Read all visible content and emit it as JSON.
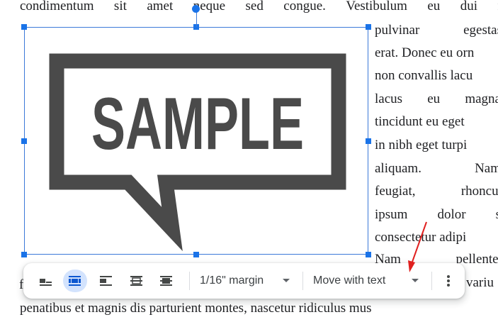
{
  "document": {
    "top_line": [
      "condimentum",
      "sit",
      "amet",
      "neque",
      "sed",
      "congue.",
      "Vestibulum",
      "eu",
      "dui",
      "n"
    ],
    "right_lines": [
      [
        "pulvinar",
        "egestas"
      ],
      [
        "erat. Donec eu orn"
      ],
      [
        "non convallis lacu"
      ],
      [
        "lacus",
        "eu",
        "magna"
      ],
      [
        "tincidunt eu eget"
      ],
      [
        "in nibh eget turpi"
      ],
      [
        "aliquam.",
        "Nam"
      ],
      [
        "feugiat,",
        "rhoncus"
      ],
      [
        "ipsum",
        "dolor",
        "s"
      ],
      [
        "consectetur adipi"
      ],
      [
        "Nam",
        "pellentes"
      ]
    ],
    "left_fragment": "f",
    "right_fragment": "variu",
    "bottom_line": "penatibus et magnis dis parturient montes, nascetur ridiculus mus"
  },
  "image": {
    "text": "SAMPLE"
  },
  "toolbar": {
    "buttons": [
      "inline-text",
      "wrap-text",
      "break-text",
      "behind-text",
      "in-front-of-text"
    ],
    "active_button": "wrap-text",
    "margin_label": "1/16\" margin",
    "position_label": "Move with text",
    "more_icon": "more-vertical-icon"
  },
  "colors": {
    "selection": "#3c79d8",
    "handle": "#1a73e8",
    "active_button_bg": "#d3e3fd",
    "image_gray": "#4a4a4a",
    "annotation_arrow": "#e0201f"
  }
}
